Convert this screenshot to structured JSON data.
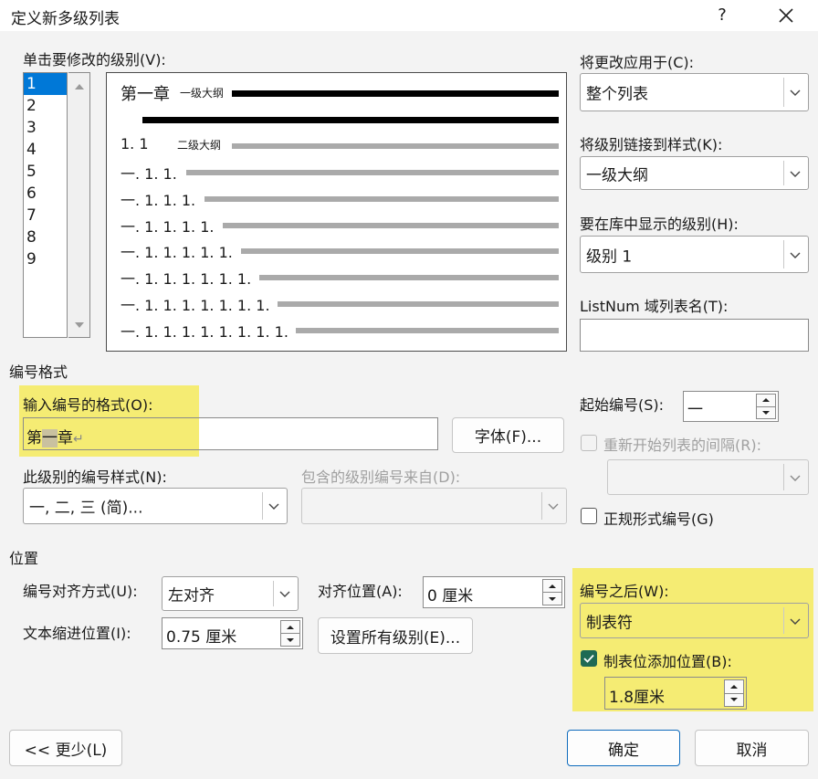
{
  "dialog": {
    "title": "定义新多级列表",
    "help_label": "?"
  },
  "level_list": {
    "label": "单击要修改的级别(V):",
    "levels": [
      "1",
      "2",
      "3",
      "4",
      "5",
      "6",
      "7",
      "8",
      "9"
    ],
    "selected": "1"
  },
  "preview": {
    "line1_num": "第一章",
    "line1_style": "一级大纲",
    "line2_num": "1. 1",
    "line2_style": "二级大纲",
    "lines": [
      "一. 1. 1.",
      "一. 1. 1. 1.",
      "一. 1. 1. 1. 1.",
      "一. 1. 1. 1. 1. 1.",
      "一. 1. 1. 1. 1. 1. 1.",
      "一. 1. 1. 1. 1. 1. 1. 1.",
      "一. 1. 1. 1. 1. 1. 1. 1. 1."
    ]
  },
  "apply_to": {
    "label": "将更改应用于(C):",
    "value": "整个列表"
  },
  "link_style": {
    "label": "将级别链接到样式(K):",
    "value": "一级大纲"
  },
  "gallery_level": {
    "label": "要在库中显示的级别(H):",
    "value": "级别 1"
  },
  "listnum": {
    "label": "ListNum 域列表名(T):",
    "value": ""
  },
  "number_format": {
    "section": "编号格式",
    "format_label": "输入编号的格式(O):",
    "format_prefix": "第",
    "format_field": "一",
    "format_suffix": "章",
    "return_mark": "↵",
    "font_button": "字体(F)...",
    "start_label": "起始编号(S):",
    "start_value": "一",
    "restart_label": "重新开始列表的间隔(R):",
    "style_label": "此级别的编号样式(N):",
    "style_value": "一, 二, 三 (简)...",
    "include_label": "包含的级别编号来自(D):",
    "legal_label": "正规形式编号(G)"
  },
  "position": {
    "section": "位置",
    "align_label": "编号对齐方式(U):",
    "align_value": "左对齐",
    "align_at_label": "对齐位置(A):",
    "align_at_value": "0 厘米",
    "indent_label": "文本缩进位置(I):",
    "indent_value": "0.75 厘米",
    "set_all_button": "设置所有级别(E)...",
    "follow_label": "编号之后(W):",
    "follow_value": "制表符",
    "tab_check_label": "制表位添加位置(B):",
    "tab_value": "1.8厘米"
  },
  "footer": {
    "less_button": "<< 更少(L)",
    "ok_button": "确定",
    "cancel_button": "取消"
  },
  "colors": {
    "highlight": "#f5ec73",
    "accent": "#0f6cbd",
    "selection": "#0078d7",
    "checkbox": "#1f6a54"
  }
}
